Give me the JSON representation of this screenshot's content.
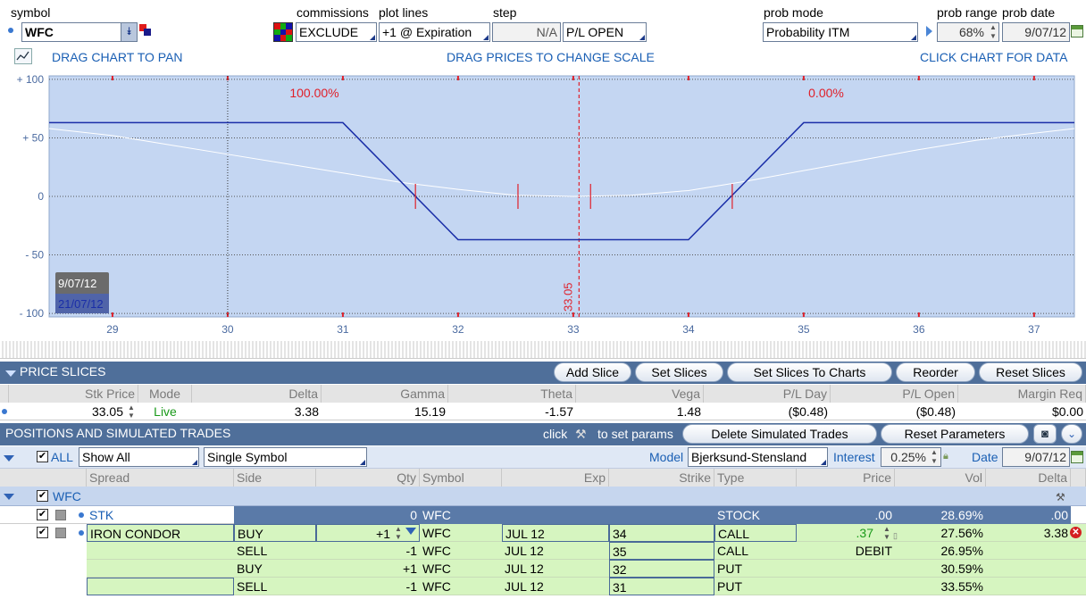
{
  "toolbar": {
    "symbol_label": "symbol",
    "symbol_value": "WFC",
    "commissions_label": "commissions",
    "commissions_value": "EXCLUDE",
    "plot_lines_label": "plot lines",
    "plot_lines_value": "+1 @ Expiration",
    "step_label": "step",
    "step_value": "N/A",
    "pl_mode_value": "P/L OPEN",
    "prob_mode_label": "prob mode",
    "prob_mode_value": "Probability ITM",
    "prob_range_label": "prob range",
    "prob_range_value": "68%",
    "prob_date_label": "prob date",
    "prob_date_value": "9/07/12"
  },
  "chart_hints": {
    "drag_pan": "DRAG CHART TO PAN",
    "drag_scale": "DRAG PRICES TO CHANGE SCALE",
    "click_data": "CLICK CHART FOR DATA"
  },
  "chart_data": {
    "type": "line",
    "xlim": [
      28.45,
      37.35
    ],
    "ylim": [
      -103,
      103
    ],
    "x_ticks": [
      "29",
      "30",
      "31",
      "32",
      "33",
      "34",
      "35",
      "36",
      "37"
    ],
    "y_ticks": [
      "+ 100",
      "+ 50",
      "0",
      "- 50",
      "- 100"
    ],
    "annotations": {
      "left_prob": "100.00%",
      "right_prob": "0.00%",
      "current_price_label": "33.05"
    },
    "current_price": 33.05,
    "date_labels": [
      "9/07/12",
      "21/07/12"
    ],
    "series": [
      {
        "name": "21/07/12",
        "color": "#1a2ea8",
        "points": [
          [
            28.45,
            63
          ],
          [
            31.0,
            63
          ],
          [
            32.0,
            -37
          ],
          [
            34.0,
            -37
          ],
          [
            35.0,
            63
          ],
          [
            37.35,
            63
          ]
        ]
      },
      {
        "name": "9/07/12",
        "color": "#ffffff",
        "points": [
          [
            28.45,
            58
          ],
          [
            29,
            52
          ],
          [
            29.5,
            44
          ],
          [
            30,
            36
          ],
          [
            30.5,
            28
          ],
          [
            31,
            20
          ],
          [
            31.5,
            12
          ],
          [
            32,
            6
          ],
          [
            32.5,
            1
          ],
          [
            33,
            0
          ],
          [
            33.5,
            1
          ],
          [
            34,
            5
          ],
          [
            34.5,
            13
          ],
          [
            35,
            22
          ],
          [
            35.5,
            31
          ],
          [
            36,
            40
          ],
          [
            36.5,
            48
          ],
          [
            37,
            54
          ],
          [
            37.35,
            58
          ]
        ]
      }
    ],
    "slice_markers": [
      31.63,
      32.52,
      33.15,
      34.38
    ]
  },
  "price_slices": {
    "title": "PRICE SLICES",
    "buttons": [
      "Add Slice",
      "Set Slices",
      "Set Slices To Charts",
      "Reorder",
      "Reset Slices"
    ],
    "headers": [
      "Stk Price",
      "Mode",
      "Delta",
      "Gamma",
      "Theta",
      "Vega",
      "P/L Day",
      "P/L Open",
      "Margin Req"
    ],
    "row": {
      "stk_price": "33.05",
      "mode": "Live",
      "delta": "3.38",
      "gamma": "15.19",
      "theta": "-1.57",
      "vega": "1.48",
      "pl_day": "($0.48)",
      "pl_open": "($0.48)",
      "margin_req": "$0.00"
    }
  },
  "positions": {
    "title": "POSITIONS AND SIMULATED TRADES",
    "click_text": "click",
    "set_params_text": "to set params",
    "delete_button": "Delete Simulated Trades",
    "reset_button": "Reset Parameters",
    "all_label": "ALL",
    "filter_value": "Show All",
    "view_value": "Single Symbol",
    "model_label": "Model",
    "model_value": "Bjerksund-Stensland",
    "interest_label": "Interest",
    "interest_value": "0.25%",
    "date_label": "Date",
    "date_value": "9/07/12",
    "headers": [
      "Spread",
      "Side",
      "Qty",
      "Symbol",
      "Exp",
      "Strike",
      "Type",
      "Price",
      "Vol",
      "Delta"
    ],
    "group": "WFC",
    "stk_row": {
      "spread": "STK",
      "qty": "0",
      "symbol": "WFC",
      "type": "STOCK",
      "price": ".00",
      "vol": "28.69%",
      "delta": ".00"
    },
    "legs": [
      {
        "spread": "IRON CONDOR",
        "side": "BUY",
        "qty": "+1",
        "symbol": "WFC",
        "exp": "JUL 12",
        "strike": "34",
        "type": "CALL",
        "price": ".37",
        "vol": "27.56%",
        "delta": "3.38"
      },
      {
        "spread": "",
        "side": "SELL",
        "qty": "-1",
        "symbol": "WFC",
        "exp": "JUL 12",
        "strike": "35",
        "type": "CALL",
        "price": "DEBIT",
        "vol": "26.95%",
        "delta": ""
      },
      {
        "spread": "",
        "side": "BUY",
        "qty": "+1",
        "symbol": "WFC",
        "exp": "JUL 12",
        "strike": "32",
        "type": "PUT",
        "price": "",
        "vol": "30.59%",
        "delta": ""
      },
      {
        "spread": "",
        "side": "SELL",
        "qty": "-1",
        "symbol": "WFC",
        "exp": "JUL 12",
        "strike": "31",
        "type": "PUT",
        "price": "",
        "vol": "33.55%",
        "delta": ""
      }
    ]
  },
  "colors": {
    "chart_bg": "#c4d6f2",
    "payoff_line": "#1a2ea8",
    "theo_line": "#ffffff",
    "accent_red": "#e0202a",
    "header_bar": "#4f6f9a",
    "leg_green": "#d6f5c0"
  }
}
